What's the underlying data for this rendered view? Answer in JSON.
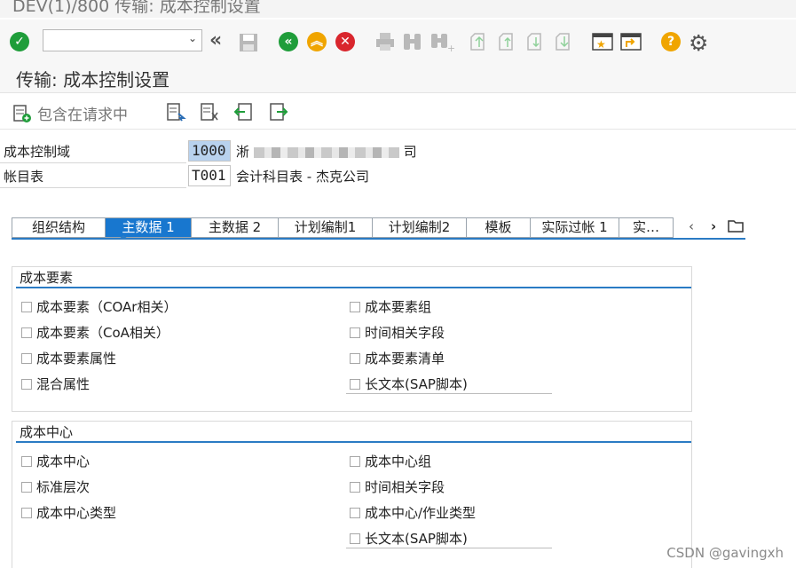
{
  "window": {
    "title": "DEV(1)/800 传输: 成本控制设置"
  },
  "toolbar": {
    "command_value": "",
    "icons": [
      "enter-check-icon",
      "back-double-arrow-icon",
      "save-icon",
      "back-icon",
      "exit-icon",
      "cancel-icon",
      "print-icon",
      "find-icon",
      "find-next-icon",
      "first-page-icon",
      "previous-page-icon",
      "next-page-icon",
      "last-page-icon",
      "new-session-icon",
      "shortcut-icon",
      "help-icon",
      "settings-gear-icon"
    ],
    "colors": {
      "green": "#1f9d3a",
      "orange": "#f0a500",
      "red": "#d9262d",
      "help": "#f0a500"
    }
  },
  "page": {
    "title": "传输: 成本控制设置"
  },
  "app_toolbar": {
    "include_request_label": "包含在请求中"
  },
  "fields": [
    {
      "label": "成本控制域",
      "value": "1000",
      "desc_prefix": "淅",
      "desc_suffix": "司"
    },
    {
      "label": "帐目表",
      "value": "T001",
      "desc": "会计科目表 - 杰克公司"
    }
  ],
  "tabs": [
    {
      "label": "组织结构",
      "active": false
    },
    {
      "label": "主数据 1",
      "active": true
    },
    {
      "label": "主数据 2",
      "active": false
    },
    {
      "label": "计划编制1",
      "active": false
    },
    {
      "label": "计划编制2",
      "active": false
    },
    {
      "label": "模板",
      "active": false
    },
    {
      "label": "实际过帐 1",
      "active": false
    },
    {
      "label": "实…",
      "active": false
    }
  ],
  "groups": [
    {
      "title": "成本要素",
      "left": [
        "成本要素（COAr相关）",
        "成本要素（CoA相关）",
        "成本要素属性",
        "混合属性"
      ],
      "right": [
        "成本要素组",
        "时间相关字段",
        "成本要素清单",
        "长文本(SAP脚本)"
      ]
    },
    {
      "title": "成本中心",
      "left": [
        "成本中心",
        "标准层次",
        "成本中心类型"
      ],
      "right": [
        "成本中心组",
        "时间相关字段",
        "成本中心/作业类型",
        "长文本(SAP脚本)"
      ]
    }
  ],
  "watermark": "CSDN @gavingxh"
}
